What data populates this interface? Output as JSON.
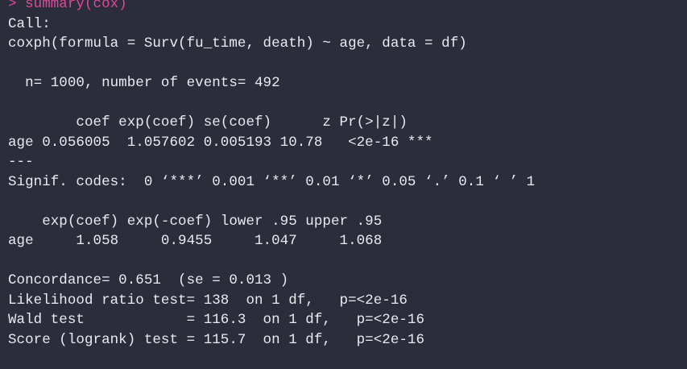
{
  "console": {
    "command": "> summary(cox)",
    "output": [
      "Call:",
      "coxph(formula = Surv(fu_time, death) ~ age, data = df)",
      "",
      "  n= 1000, number of events= 492",
      "",
      "        coef exp(coef) se(coef)      z Pr(>|z|)",
      "age 0.056005  1.057602 0.005193 10.78   <2e-16 ***",
      "---",
      "Signif. codes:  0 ‘***’ 0.001 ‘**’ 0.01 ‘*’ 0.05 ‘.’ 0.1 ‘ ’ 1",
      "",
      "    exp(coef) exp(-coef) lower .95 upper .95",
      "age     1.058     0.9455     1.047     1.068",
      "",
      "Concordance= 0.651  (se = 0.013 )",
      "Likelihood ratio test= 138  on 1 df,   p=<2e-16",
      "Wald test            = 116.3  on 1 df,   p=<2e-16",
      "Score (logrank) test = 115.7  on 1 df,   p=<2e-16"
    ]
  },
  "colors": {
    "background": "#2b2d3b",
    "command_text": "#e0479e",
    "output_text": "#eaeaf0"
  }
}
